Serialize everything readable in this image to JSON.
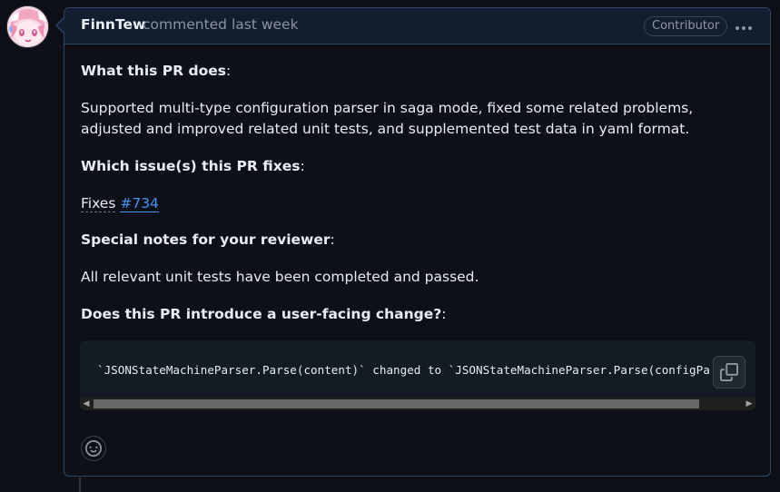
{
  "comment": {
    "author": "FinnTew",
    "meta": "commented last week",
    "badge": "Contributor",
    "menu_icon": "kebab-horizontal-icon"
  },
  "body": {
    "h1": "What this PR does",
    "p1": "Supported multi-type configuration parser in saga mode, fixed some related problems, adjusted and improved related unit tests, and supplemented test data in yaml format.",
    "h2": "Which issue(s) this PR fixes",
    "fixes_label": "Fixes",
    "fixes_link": "#734",
    "h3": "Special notes for your reviewer",
    "p3": "All relevant unit tests have been completed and passed.",
    "h4": "Does this PR introduce a user-facing change?",
    "colon": ":",
    "code": "`JSONStateMachineParser.Parse(content)` changed to `JSONStateMachineParser.Parse(configPa"
  },
  "icons": {
    "copy": "copy-icon",
    "smiley": "smiley-icon",
    "scroll_left": "◀",
    "scroll_right": "▶"
  },
  "colors": {
    "background": "#0d1117",
    "header": "#121d2f",
    "border": "#2f4668",
    "link": "#4493f8",
    "muted": "#8b949e"
  }
}
